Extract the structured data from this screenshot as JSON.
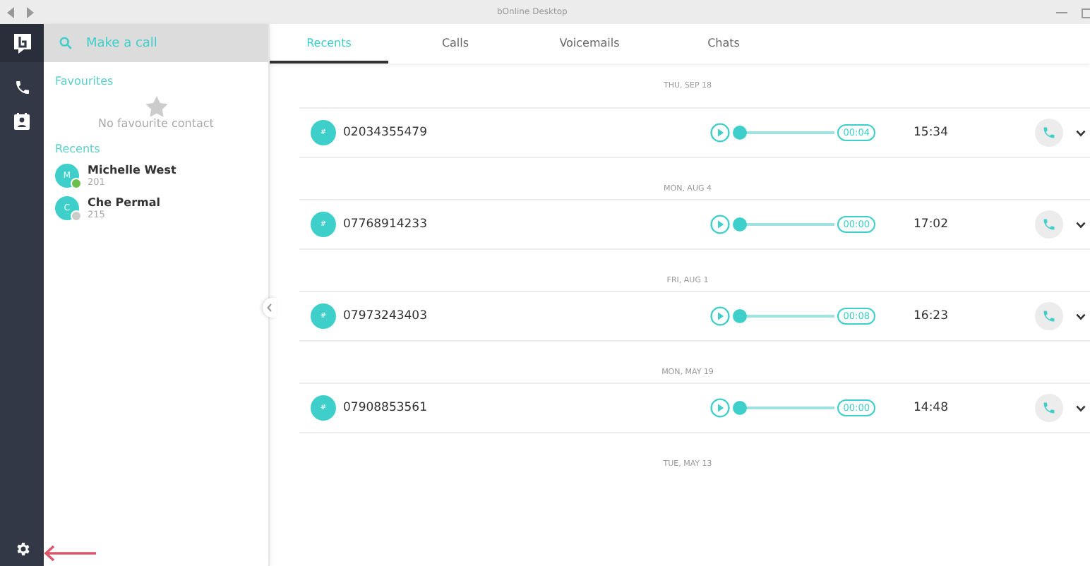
{
  "window": {
    "title": "bOnline Desktop"
  },
  "search": {
    "placeholder": "Make a call"
  },
  "favourites": {
    "heading": "Favourites",
    "empty_text": "No favourite contact"
  },
  "recents": {
    "heading": "Recents",
    "contacts": [
      {
        "initial": "M",
        "name": "Michelle West",
        "extension": "201",
        "color": "#6cc04a"
      },
      {
        "initial": "C",
        "name": "Che Permal",
        "extension": "215",
        "color": "#cccccc"
      }
    ]
  },
  "tabs": [
    {
      "label": "Recents",
      "selected": true
    },
    {
      "label": "Calls",
      "selected": false
    },
    {
      "label": "Voicemails",
      "selected": false
    },
    {
      "label": "Chats",
      "selected": false
    }
  ],
  "groups": [
    {
      "date": "THU, SEP 18",
      "calls": [
        {
          "avatar": "#",
          "number": "02034355479",
          "level": 0,
          "duration": "00:04",
          "time": "15:34"
        }
      ]
    },
    {
      "date": "MON, AUG 4",
      "calls": [
        {
          "avatar": "#",
          "number": "07768914233",
          "level": 0,
          "duration": "00:00",
          "time": "17:02"
        }
      ]
    },
    {
      "date": "FRI, AUG 1",
      "calls": [
        {
          "avatar": "#",
          "number": "07973243403",
          "level": 0,
          "duration": "00:08",
          "time": "16:23"
        }
      ]
    },
    {
      "date": "MON, MAY 19",
      "calls": [
        {
          "avatar": "#",
          "number": "07908853561",
          "level": 0,
          "duration": "00:00",
          "time": "14:48"
        }
      ]
    },
    {
      "date": "TUE, MAY 13"
    }
  ]
}
